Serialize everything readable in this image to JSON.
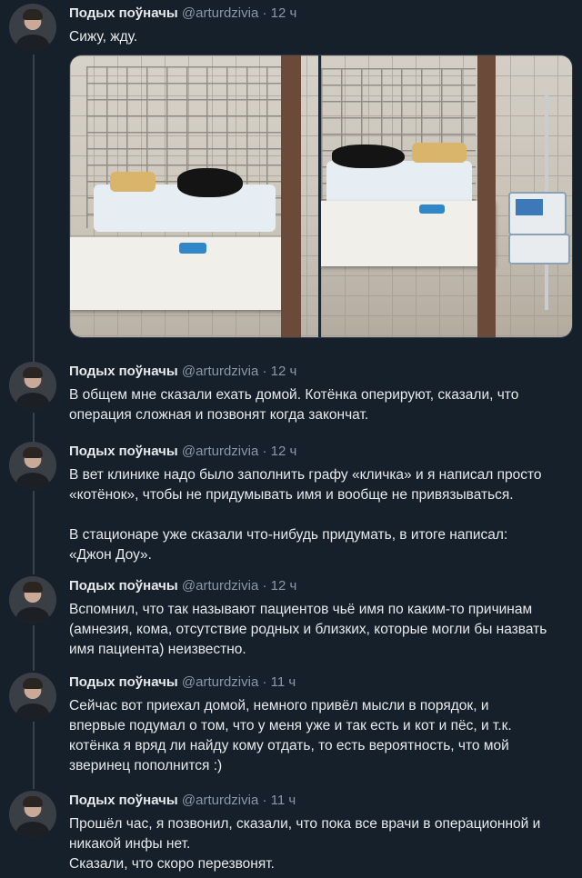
{
  "tweets": [
    {
      "name": "Подых поўначы",
      "handle": "@arturdzivia",
      "separator": "·",
      "time": "12 ч",
      "text": "Сижу, жду.",
      "media": {
        "photos": [
          {
            "description": "cage-with-cat-left"
          },
          {
            "description": "cage-with-cat-right"
          }
        ]
      }
    },
    {
      "name": "Подых поўначы",
      "handle": "@arturdzivia",
      "separator": "·",
      "time": "12 ч",
      "text": "В общем мне сказали ехать домой. Котёнка оперируют, сказали, что\nоперация сложная и позвонят когда закончат."
    },
    {
      "name": "Подых поўначы",
      "handle": "@arturdzivia",
      "separator": "·",
      "time": "12 ч",
      "text": "В вет клинике надо было заполнить графу «кличка» и я написал просто\n«котёнок», чтобы не придумывать имя и вообще не привязываться.\n\nВ стационаре уже сказали что-нибудь придумать, в итоге написал:\n«Джон Доу»."
    },
    {
      "name": "Подых поўначы",
      "handle": "@arturdzivia",
      "separator": "·",
      "time": "12 ч",
      "text": "Вспомнил, что так называют пациентов чьё имя по каким-то причинам\n(амнезия, кома, отсутствие родных и близких, которые могли бы назвать\nимя пациента) неизвестно."
    },
    {
      "name": "Подых поўначы",
      "handle": "@arturdzivia",
      "separator": "·",
      "time": "11 ч",
      "text": "Сейчас вот приехал домой, немного привёл мысли в порядок, и\nвпервые подумал о том, что у меня уже и так есть и кот и пёс, и т.к.\nкотёнка я вряд ли найду кому отдать, то есть вероятность, что мой\nзверинец пополнится :)"
    },
    {
      "name": "Подых поўначы",
      "handle": "@arturdzivia",
      "separator": "·",
      "time": "11 ч",
      "text": "Прошёл час, я позвонил, сказали, что пока все врачи в операционной и\nникакой инфы нет.\nСказали, что скоро перезвонят."
    }
  ]
}
